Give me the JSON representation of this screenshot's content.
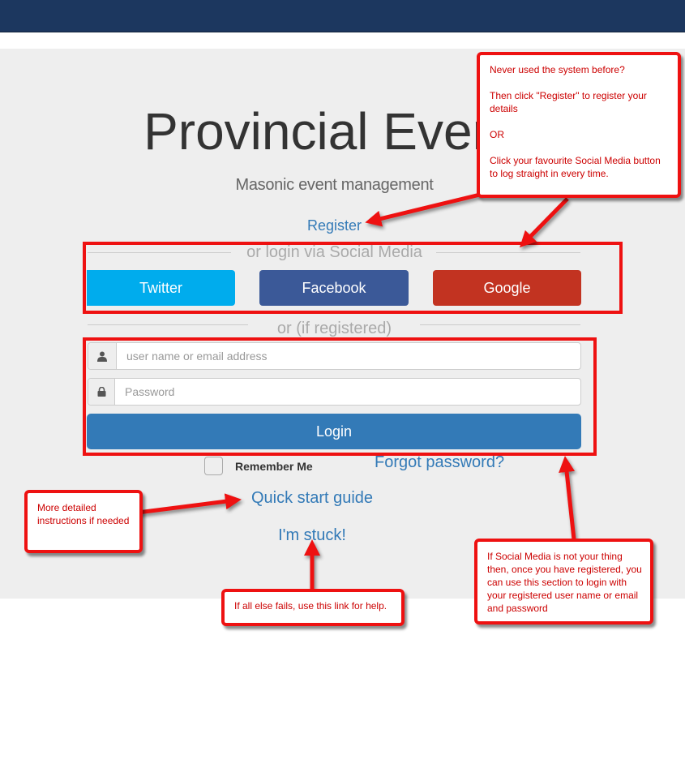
{
  "header": {},
  "hero": {
    "title": "Provincial Events",
    "subtitle": "Masonic event management",
    "register_link": "Register"
  },
  "social": {
    "divider_text": "or login via Social Media",
    "buttons": [
      {
        "label": "Twitter",
        "color": "#00aced"
      },
      {
        "label": "Facebook",
        "color": "#3b5998"
      },
      {
        "label": "Google",
        "color": "#c23321"
      }
    ]
  },
  "login": {
    "divider_text": "or (if registered)",
    "username_placeholder": "user name or email address",
    "username_icon": "user-icon",
    "password_placeholder": "Password",
    "password_icon": "lock-icon",
    "button_label": "Login",
    "remember_label": "Remember Me",
    "forgot_link": "Forgot password?"
  },
  "help": {
    "quick_start_link": "Quick start guide",
    "stuck_link": "I'm stuck!"
  },
  "annotations": {
    "register_note": {
      "line1": "Never used the system before?",
      "line2": "Then click \"Register\" to register your details",
      "line3": "OR",
      "line4": "Click your favourite Social Media button to log straight in every time."
    },
    "guide_note": "More detailed instructions if needed",
    "stuck_note": "If all else fails, use this link for help.",
    "login_note": "If Social Media is not your thing then, once you have registered, you can use this section to login with your registered user name or email and password",
    "accent_color": "#ee1111"
  },
  "colors": {
    "navbar": "#1c375f",
    "jumbotron": "#eeeeee",
    "link": "#337ab7",
    "primary": "#337ab7"
  }
}
